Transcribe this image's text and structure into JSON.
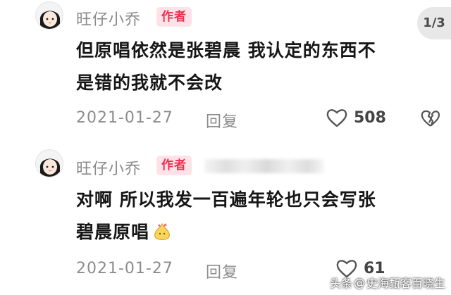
{
  "page_indicator": "1/3",
  "comments": [
    {
      "username": "旺仔小乔",
      "badge": "作者",
      "lines": [
        "但原唱依然是张碧晨 我认定的东西不",
        "是错的我就不会改"
      ],
      "date": "2021-01-27",
      "reply_label": "回复",
      "likes": "508",
      "icons": [
        "avatar",
        "heart-icon",
        "broken-heart-icon"
      ]
    },
    {
      "username": "旺仔小乔",
      "badge": "作者",
      "lines": [
        "对啊 所以我发一百遍年轮也只会写张",
        "碧晨原唱"
      ],
      "date": "2021-01-27",
      "reply_label": "回复",
      "likes": "61",
      "icons": [
        "avatar",
        "heart-icon",
        "sparkle-emoji-icon"
      ]
    }
  ],
  "watermark": {
    "prefix": "头条",
    "at": "@",
    "account": "史海甄客百晓生"
  },
  "colors": {
    "badge_bg": "#fde3e7",
    "badge_text": "#ec2f50",
    "meta_gray": "#8c8c8c"
  }
}
